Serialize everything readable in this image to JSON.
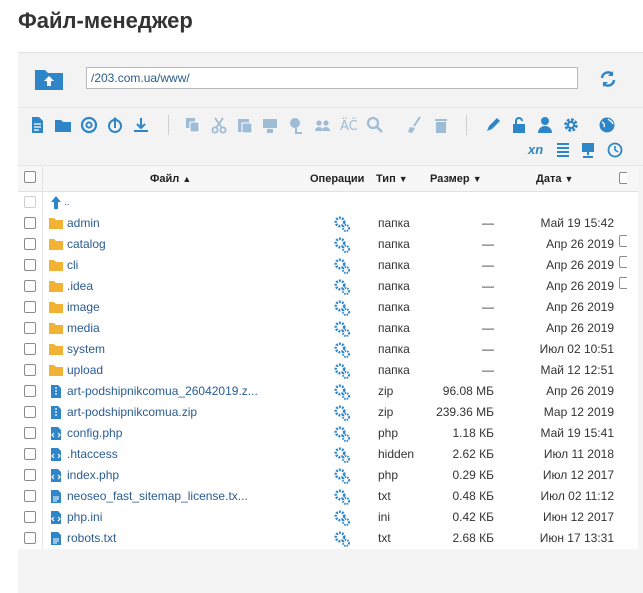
{
  "page": {
    "title": "Файл-менеджер"
  },
  "urlbar": {
    "path": "/203.com.ua/www/"
  },
  "toolbar": {
    "row1": [
      "file-icon",
      "folder-icon",
      "at-icon",
      "upload-icon",
      "download-icon",
      "copy-icon",
      "cut-icon",
      "paste-icon",
      "archive-icon",
      "extract-icon",
      "users-icon",
      "rename-icon",
      "search-icon",
      "clean-icon",
      "trash-icon",
      "edit-icon",
      "unlock-icon",
      "user-icon",
      "gear-icon",
      "globe-icon"
    ],
    "row2": [
      "xn-label-icon",
      "list-icon",
      "monitor-icon",
      "history-icon"
    ],
    "xn_label": "xn"
  },
  "table": {
    "headers": {
      "name": "Файл",
      "ops": "Операции",
      "type": "Тип",
      "size": "Размер",
      "date": "Дата"
    },
    "parent_label": "..",
    "rows": [
      {
        "name": "admin",
        "kind": "folder",
        "type": "папка",
        "size": "—",
        "date": "Май 19 15:42"
      },
      {
        "name": "catalog",
        "kind": "folder",
        "type": "папка",
        "size": "—",
        "date": "Апр 26 2019"
      },
      {
        "name": "cli",
        "kind": "folder",
        "type": "папка",
        "size": "—",
        "date": "Апр 26 2019"
      },
      {
        "name": ".idea",
        "kind": "folder",
        "type": "папка",
        "size": "—",
        "date": "Апр 26 2019"
      },
      {
        "name": "image",
        "kind": "folder",
        "type": "папка",
        "size": "—",
        "date": "Апр 26 2019"
      },
      {
        "name": "media",
        "kind": "folder",
        "type": "папка",
        "size": "—",
        "date": "Апр 26 2019"
      },
      {
        "name": "system",
        "kind": "folder",
        "type": "папка",
        "size": "—",
        "date": "Июл 02 10:51"
      },
      {
        "name": "upload",
        "kind": "folder",
        "type": "папка",
        "size": "—",
        "date": "Май 12 12:51"
      },
      {
        "name": "art-podshipnikcomua_26042019.z...",
        "kind": "zip",
        "type": "zip",
        "size": "96.08 МБ",
        "date": "Апр 26 2019"
      },
      {
        "name": "art-podshipnikcomua.zip",
        "kind": "zip",
        "type": "zip",
        "size": "239.36 МБ",
        "date": "Мар 12 2019"
      },
      {
        "name": "config.php",
        "kind": "php",
        "type": "php",
        "size": "1.18 КБ",
        "date": "Май 19 15:41"
      },
      {
        "name": ".htaccess",
        "kind": "code",
        "type": "hidden",
        "size": "2.62 КБ",
        "date": "Июл 11 2018"
      },
      {
        "name": "index.php",
        "kind": "php",
        "type": "php",
        "size": "0.29 КБ",
        "date": "Июл 12 2017"
      },
      {
        "name": "neoseo_fast_sitemap_license.tx...",
        "kind": "text",
        "type": "txt",
        "size": "0.48 КБ",
        "date": "Июл 02 11:12"
      },
      {
        "name": "php.ini",
        "kind": "code",
        "type": "ini",
        "size": "0.42 КБ",
        "date": "Июн 12 2017"
      },
      {
        "name": "robots.txt",
        "kind": "text",
        "type": "txt",
        "size": "2.68 КБ",
        "date": "Июн 17 13:31"
      }
    ]
  }
}
